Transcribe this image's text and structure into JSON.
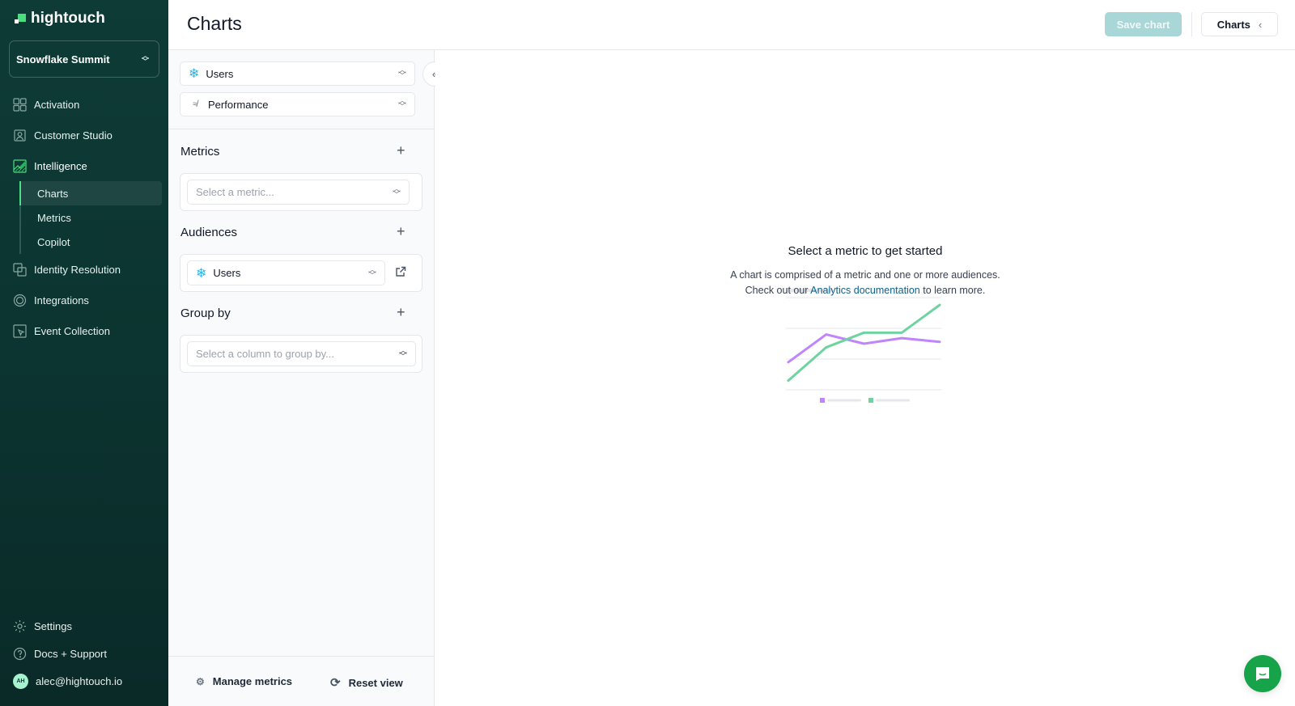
{
  "brand": {
    "name": "hightouch",
    "accent": "#4ade80"
  },
  "workspace": {
    "name": "Snowflake Summit"
  },
  "nav": {
    "items": [
      {
        "label": "Activation",
        "icon": "activation-icon"
      },
      {
        "label": "Customer Studio",
        "icon": "customer-studio-icon"
      },
      {
        "label": "Intelligence",
        "icon": "intelligence-icon",
        "active": true
      }
    ],
    "sub_items": [
      {
        "label": "Charts",
        "active": true
      },
      {
        "label": "Metrics"
      },
      {
        "label": "Copilot"
      }
    ],
    "items_after": [
      {
        "label": "Identity Resolution",
        "icon": "identity-resolution-icon"
      },
      {
        "label": "Integrations",
        "icon": "integrations-icon"
      },
      {
        "label": "Event Collection",
        "icon": "event-collection-icon"
      }
    ],
    "bottom": [
      {
        "label": "Settings",
        "icon": "gear-icon"
      },
      {
        "label": "Docs + Support",
        "icon": "help-icon"
      },
      {
        "label": "alec@hightouch.io",
        "avatar_initials": "AH"
      }
    ]
  },
  "header": {
    "title": "Charts",
    "save_label": "Save chart",
    "charts_label": "Charts"
  },
  "panel": {
    "source_select": {
      "value": "Users"
    },
    "chart_type_select": {
      "value": "Performance"
    },
    "metrics": {
      "title": "Metrics",
      "placeholder": "Select a metric..."
    },
    "audiences": {
      "title": "Audiences",
      "value": "Users"
    },
    "group_by": {
      "title": "Group by",
      "placeholder": "Select a column to group by..."
    },
    "footer": {
      "manage_label": "Manage metrics",
      "reset_label": "Reset view"
    }
  },
  "empty_state": {
    "title": "Select a metric to get started",
    "desc_line1": "A chart is comprised of a metric and one or more audiences.",
    "desc_prefix": "Check out our ",
    "desc_link": "Analytics documentation",
    "desc_suffix": " to learn more.",
    "illustration_series": [
      {
        "color": "#c084fc",
        "values": [
          3,
          6,
          5,
          5.6,
          5.2
        ]
      },
      {
        "color": "#6ed3a0",
        "values": [
          1,
          4.6,
          6.2,
          6.2,
          9.2
        ]
      }
    ]
  }
}
